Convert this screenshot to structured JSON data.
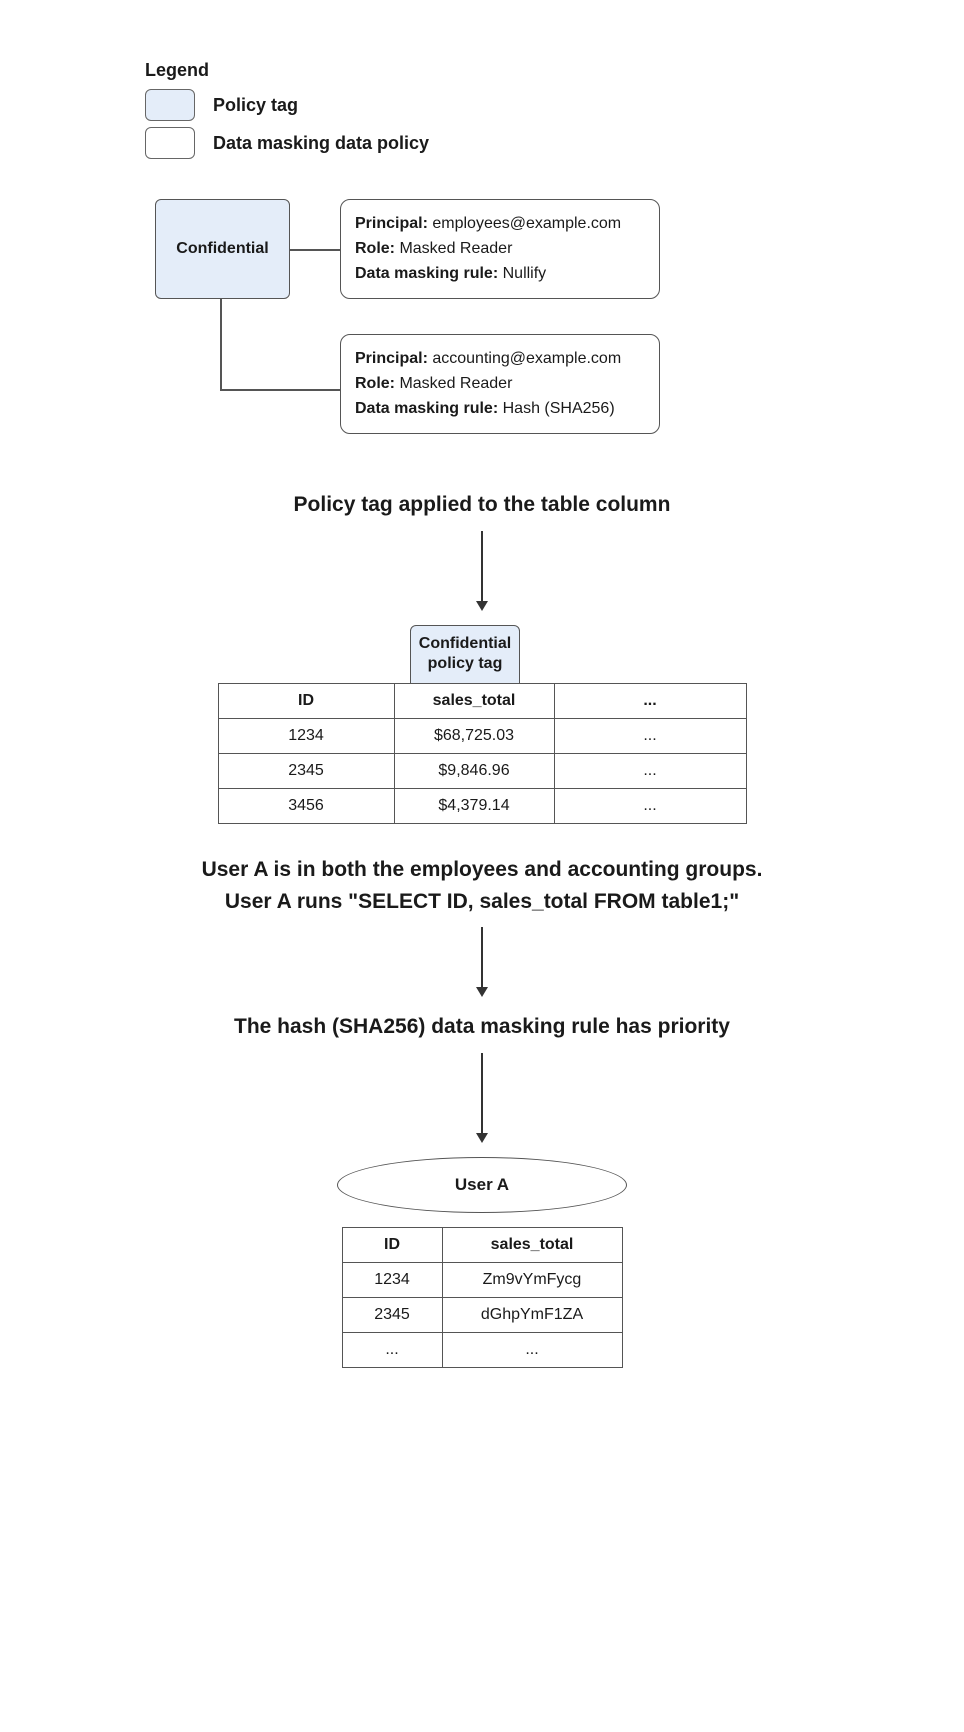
{
  "legend": {
    "title": "Legend",
    "policy_tag": "Policy tag",
    "data_masking_policy": "Data masking data policy"
  },
  "confidential_box_label": "Confidential",
  "policies": [
    {
      "principal_label": "Principal:",
      "principal_value": "employees@example.com",
      "role_label": "Role:",
      "role_value": "Masked Reader",
      "rule_label": "Data masking rule:",
      "rule_value": "Nullify"
    },
    {
      "principal_label": "Principal:",
      "principal_value": "accounting@example.com",
      "role_label": "Role:",
      "role_value": "Masked Reader",
      "rule_label": "Data masking rule:",
      "rule_value": "Hash (SHA256)"
    }
  ],
  "heading_applied": "Policy tag applied to the table column",
  "confidential_tag_line1": "Confidential",
  "confidential_tag_line2": "policy tag",
  "table1": {
    "headers": [
      "ID",
      "sales_total",
      "..."
    ],
    "rows": [
      [
        "1234",
        "$68,725.03",
        "..."
      ],
      [
        "2345",
        "$9,846.96",
        "..."
      ],
      [
        "3456",
        "$4,379.14",
        "..."
      ]
    ]
  },
  "heading_user_line1": "User A is in both the employees and accounting groups.",
  "heading_user_line2": "User A runs \"SELECT ID, sales_total FROM table1;\"",
  "heading_priority": "The hash (SHA256) data masking rule has priority",
  "user_a_label": "User A",
  "table2": {
    "headers": [
      "ID",
      "sales_total"
    ],
    "rows": [
      [
        "1234",
        "Zm9vYmFycg"
      ],
      [
        "2345",
        "dGhpYmF1ZA"
      ],
      [
        "...",
        "..."
      ]
    ]
  }
}
